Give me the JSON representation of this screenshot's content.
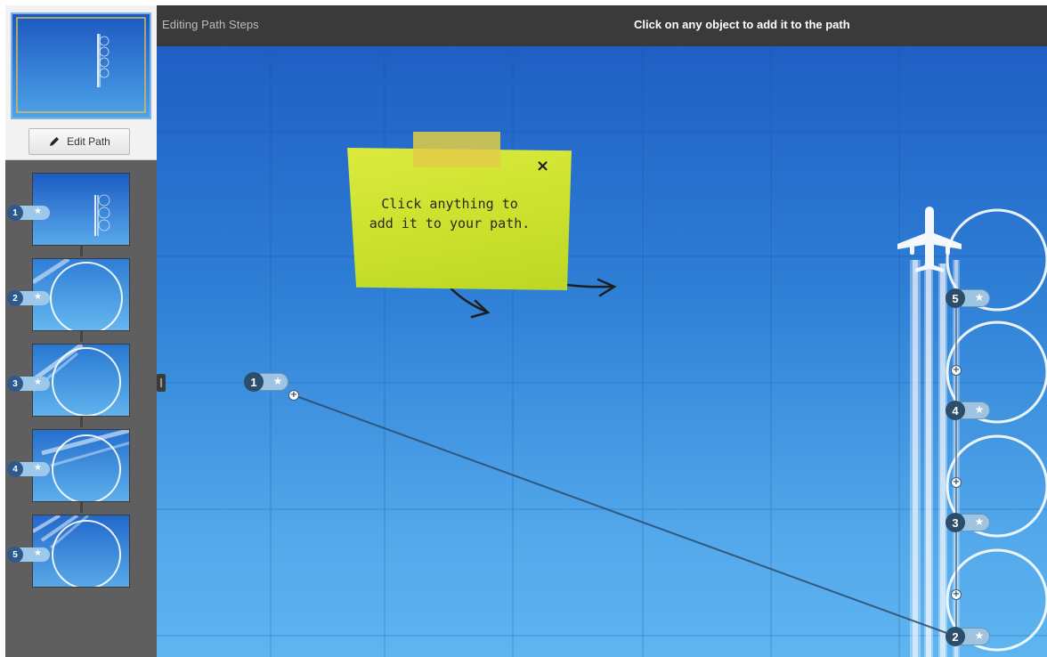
{
  "topbar": {
    "left_label": "Editing Path Steps",
    "center_label": "Click on any object to add it to the path"
  },
  "sidebar": {
    "edit_path_label": "Edit Path",
    "steps": [
      {
        "number": "1"
      },
      {
        "number": "2"
      },
      {
        "number": "3"
      },
      {
        "number": "4"
      },
      {
        "number": "5"
      }
    ]
  },
  "sticky_note": {
    "line1": "Click anything to",
    "line2": "add it to your path.",
    "close": "×"
  },
  "markers": {
    "m1": "1",
    "m2": "2",
    "m3": "3",
    "m4": "4",
    "m5": "5",
    "star": "★",
    "plus": "+"
  },
  "colors": {
    "accent": "#2d4e6b",
    "topbar": "#3a3a3a",
    "sidebar": "#5f5f5f",
    "note": "#cfe22f"
  },
  "icons": {
    "edit_path": "pencil-icon",
    "close": "close-icon",
    "marker": "star-icon",
    "handle": "plus-icon"
  }
}
